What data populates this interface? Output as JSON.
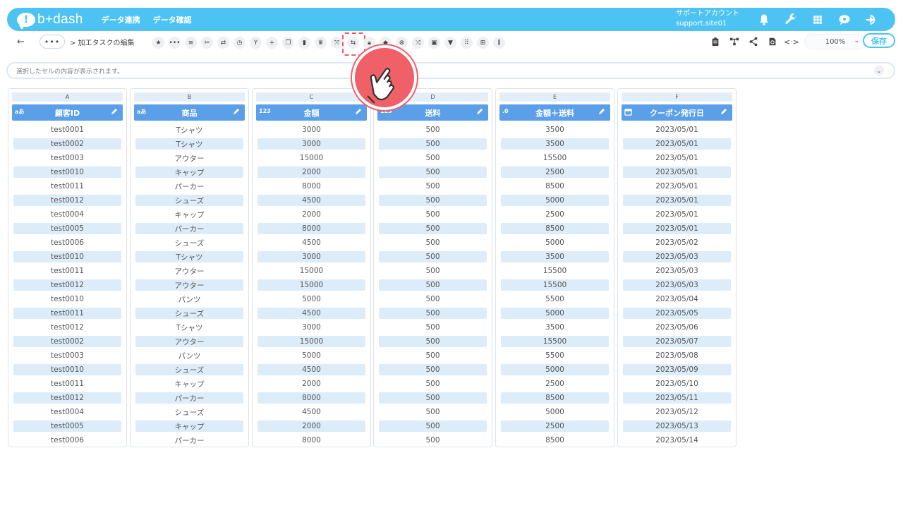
{
  "header": {
    "logo_mark": "!",
    "logo_text": "b+dash",
    "nav": [
      "データ連携",
      "データ確認"
    ],
    "account_name": "サポートアカウント",
    "account_id": "support.site01"
  },
  "toolbar": {
    "back": "←",
    "more": "•••",
    "breadcrumb": "> 加工タスクの編集",
    "zoom": "100%",
    "save": "保存"
  },
  "cellbar": {
    "placeholder": "選択したセルの内容が表示されます。"
  },
  "columns": [
    {
      "letter": "A",
      "name": "顧客ID",
      "type": "aあ",
      "values": [
        "test0001",
        "test0002",
        "test0003",
        "test0010",
        "test0011",
        "test0012",
        "test0004",
        "test0005",
        "test0006",
        "test0010",
        "test0011",
        "test0012",
        "test0010",
        "test0011",
        "test0012",
        "test0002",
        "test0003",
        "test0010",
        "test0011",
        "test0012",
        "test0004",
        "test0005",
        "test0006"
      ]
    },
    {
      "letter": "B",
      "name": "商品",
      "type": "aあ",
      "values": [
        "Tシャツ",
        "Tシャツ",
        "アウター",
        "キャップ",
        "パーカー",
        "シューズ",
        "キャップ",
        "パーカー",
        "シューズ",
        "Tシャツ",
        "アウター",
        "アウター",
        "パンツ",
        "シューズ",
        "Tシャツ",
        "アウター",
        "パンツ",
        "シューズ",
        "キャップ",
        "パーカー",
        "シューズ",
        "キャップ",
        "パーカー"
      ]
    },
    {
      "letter": "C",
      "name": "金額",
      "type": "123",
      "values": [
        "3000",
        "3000",
        "15000",
        "2000",
        "8000",
        "4500",
        "2000",
        "8000",
        "4500",
        "3000",
        "15000",
        "15000",
        "5000",
        "4500",
        "3000",
        "15000",
        "5000",
        "4500",
        "2000",
        "8000",
        "4500",
        "2000",
        "8000"
      ]
    },
    {
      "letter": "D",
      "name": "送料",
      "type": "123",
      "values": [
        "500",
        "500",
        "500",
        "500",
        "500",
        "500",
        "500",
        "500",
        "500",
        "500",
        "500",
        "500",
        "500",
        "500",
        "500",
        "500",
        "500",
        "500",
        "500",
        "500",
        "500",
        "500",
        "500"
      ]
    },
    {
      "letter": "E",
      "name": "金額＋送料",
      "type": ".0",
      "values": [
        "3500",
        "3500",
        "15500",
        "2500",
        "8500",
        "5000",
        "2500",
        "8500",
        "5000",
        "3500",
        "15500",
        "15500",
        "5500",
        "5000",
        "3500",
        "15500",
        "5500",
        "5000",
        "2500",
        "8500",
        "5000",
        "2500",
        "8500"
      ]
    },
    {
      "letter": "F",
      "name": "クーポン発行日",
      "type": "cal",
      "values": [
        "2023/05/01",
        "2023/05/01",
        "2023/05/01",
        "2023/05/01",
        "2023/05/01",
        "2023/05/01",
        "2023/05/01",
        "2023/05/01",
        "2023/05/02",
        "2023/05/03",
        "2023/05/03",
        "2023/05/03",
        "2023/05/04",
        "2023/05/05",
        "2023/05/06",
        "2023/05/07",
        "2023/05/08",
        "2023/05/09",
        "2023/05/10",
        "2023/05/11",
        "2023/05/12",
        "2023/05/13",
        "2023/05/14"
      ]
    }
  ],
  "tool_icons": [
    "star-icon",
    "dots-icon",
    "list-icon",
    "tools-icon",
    "swap-icon",
    "timer-icon",
    "branch-icon",
    "plus-icon",
    "copy-icon",
    "trash-icon",
    "crown-icon",
    "expand-icon",
    "transpose-icon",
    "lock-icon",
    "box-icon",
    "close-circle-icon",
    "shuffle-icon",
    "square-icon",
    "filter-icon",
    "grid-text-icon",
    "table-icon",
    "split-icon"
  ],
  "colors": {
    "accent": "#4dc3f4",
    "column_header": "#5b9fe8",
    "highlight": "#ef5b66"
  }
}
